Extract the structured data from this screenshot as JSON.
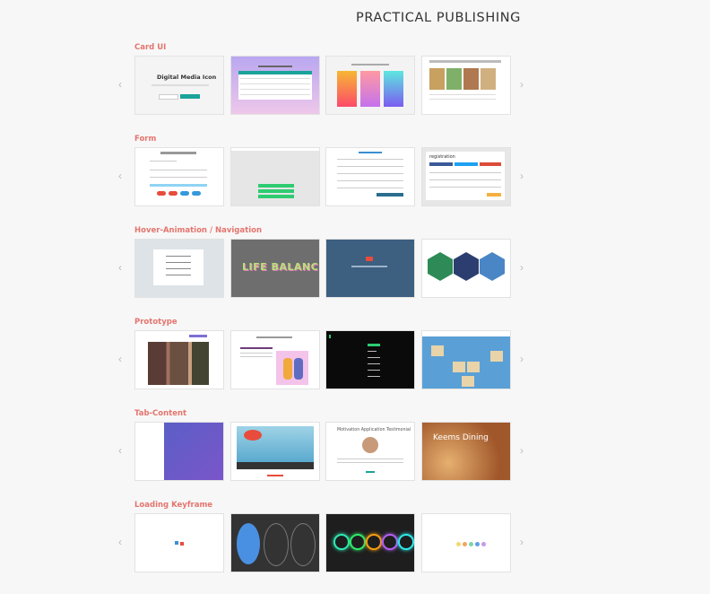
{
  "brand": "PRACTICAL PUBLISHING",
  "nav": {
    "prev": "‹",
    "next": "›"
  },
  "sections": [
    {
      "title": "Card UI",
      "thumbs": [
        "Digital Media Icon",
        "",
        "",
        ""
      ]
    },
    {
      "title": "Form",
      "thumbs": [
        "",
        "",
        "",
        "registration"
      ]
    },
    {
      "title": "Hover-Animation / Navigation",
      "thumbs": [
        "",
        "LIFE BALANCE",
        "",
        ""
      ]
    },
    {
      "title": "Prototype",
      "thumbs": [
        "",
        "",
        "",
        ""
      ]
    },
    {
      "title": "Tab-Content",
      "thumbs": [
        "",
        "",
        "Motivation Application Testimonial",
        "Keems Dining"
      ]
    },
    {
      "title": "Loading Keyframe",
      "thumbs": [
        "",
        "",
        "",
        ""
      ]
    }
  ],
  "colors": {
    "accent": "#e4756e",
    "teal": "#1aa39a",
    "navy": "#3d5f80"
  }
}
